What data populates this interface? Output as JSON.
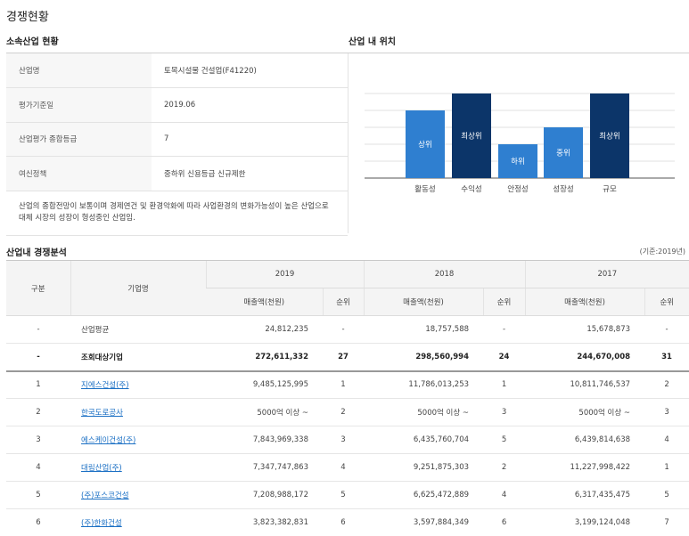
{
  "page_title": "경쟁현황",
  "industry_section_title": "소속산업 현황",
  "position_section_title": "산업 내 위치",
  "industry_info": [
    {
      "label": "산업명",
      "value": "토목시설물 건설업(F41220)"
    },
    {
      "label": "평가기준일",
      "value": "2019.06"
    },
    {
      "label": "산업평가 종합등급",
      "value": "7"
    },
    {
      "label": "여신정책",
      "value": "중하위 신용등급 신규제한"
    }
  ],
  "industry_description": "산업의 종합전망이 보통이며 경제연건 및 환경악화에 따라 사업환경의 변화가능성이 높은 산업으로 대체 시장의 성장이 형성중인 산업임.",
  "position_chart": {
    "categories": [
      "활동성",
      "수익성",
      "안정성",
      "성장성",
      "규모"
    ],
    "levels": [
      "상위",
      "최상위",
      "하위",
      "중위",
      "최상위"
    ],
    "level_values": [
      4,
      5,
      2,
      3,
      5
    ],
    "colors": {
      "light": "#2f7fd0",
      "dark": "#0c3569"
    }
  },
  "competition_title": "산업내 경쟁분석",
  "base_note": "(기준:2019년)",
  "table_headers": {
    "group": "구분",
    "company": "기업명",
    "years": [
      "2019",
      "2018",
      "2017"
    ],
    "sales": "매출액(천원)",
    "rank": "순위"
  },
  "rows": [
    {
      "group": "-",
      "company": "산업평균",
      "link": false,
      "bold": false,
      "s2019": "24,812,235",
      "r2019": "-",
      "s2018": "18,757,588",
      "r2018": "-",
      "s2017": "15,678,873",
      "r2017": "-"
    },
    {
      "group": "-",
      "company": "조회대상기업",
      "link": false,
      "bold": true,
      "s2019": "272,611,332",
      "r2019": "27",
      "s2018": "298,560,994",
      "r2018": "24",
      "s2017": "244,670,008",
      "r2017": "31"
    },
    {
      "group": "1",
      "company": "지에스건설(주)",
      "link": true,
      "bold": false,
      "s2019": "9,485,125,995",
      "r2019": "1",
      "s2018": "11,786,013,253",
      "r2018": "1",
      "s2017": "10,811,746,537",
      "r2017": "2"
    },
    {
      "group": "2",
      "company": "한국도로공사",
      "link": true,
      "bold": false,
      "s2019": "5000억 이상 ~",
      "r2019": "2",
      "s2018": "5000억 이상 ~",
      "r2018": "3",
      "s2017": "5000억 이상 ~",
      "r2017": "3"
    },
    {
      "group": "3",
      "company": "에스케이건설(주)",
      "link": true,
      "bold": false,
      "s2019": "7,843,969,338",
      "r2019": "3",
      "s2018": "6,435,760,704",
      "r2018": "5",
      "s2017": "6,439,814,638",
      "r2017": "4"
    },
    {
      "group": "4",
      "company": "대림산업(주)",
      "link": true,
      "bold": false,
      "s2019": "7,347,747,863",
      "r2019": "4",
      "s2018": "9,251,875,303",
      "r2018": "2",
      "s2017": "11,227,998,422",
      "r2017": "1"
    },
    {
      "group": "5",
      "company": "(주)포스코건설",
      "link": true,
      "bold": false,
      "s2019": "7,208,988,172",
      "r2019": "5",
      "s2018": "6,625,472,889",
      "r2018": "4",
      "s2017": "6,317,435,475",
      "r2017": "5"
    },
    {
      "group": "6",
      "company": "(주)한화건설",
      "link": true,
      "bold": false,
      "s2019": "3,823,382,831",
      "r2019": "6",
      "s2018": "3,597,884,349",
      "r2018": "6",
      "s2017": "3,199,124,048",
      "r2017": "7"
    }
  ]
}
